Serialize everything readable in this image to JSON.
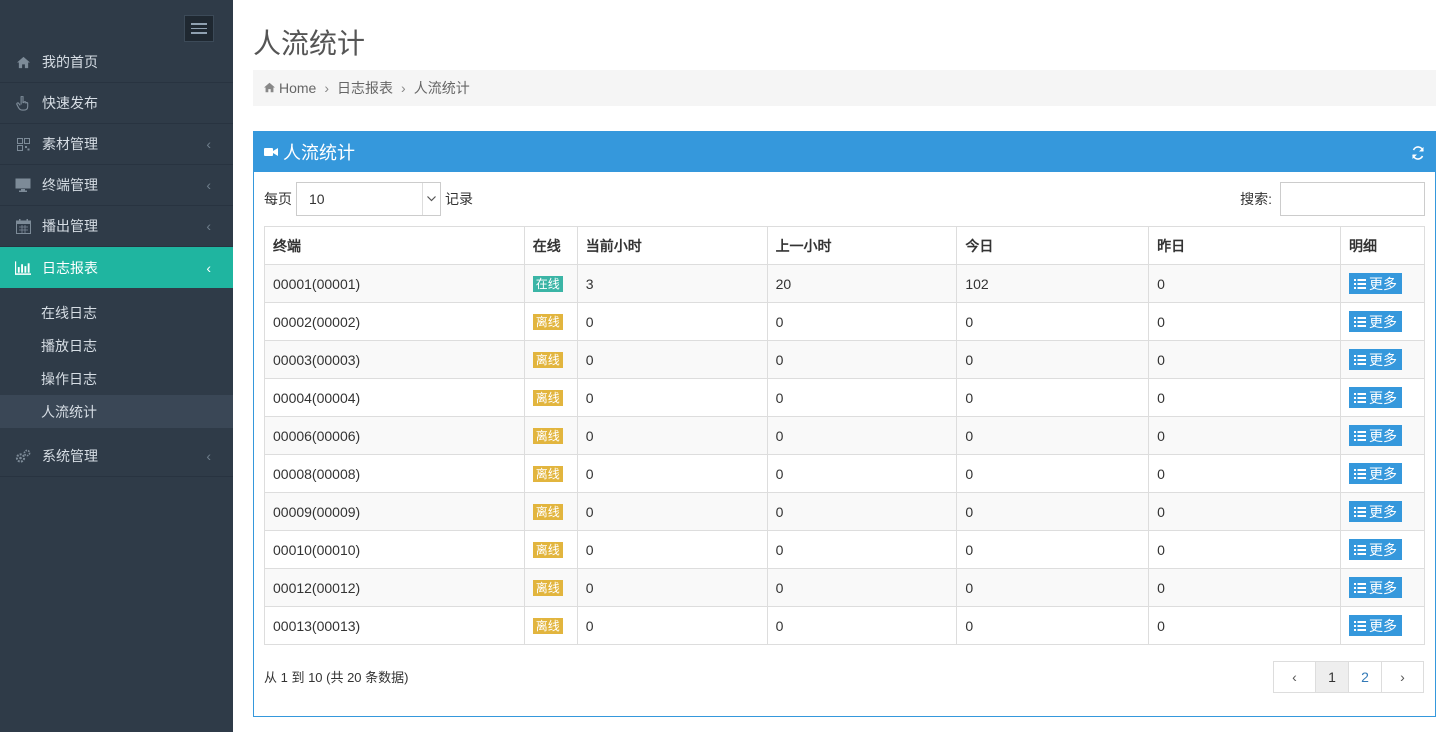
{
  "sidebar": {
    "menu": [
      {
        "label": "我的首页",
        "icon": "home-icon",
        "arrow": ""
      },
      {
        "label": "快速发布",
        "icon": "hand-pointer-icon",
        "arrow": ""
      },
      {
        "label": "素材管理",
        "icon": "qrcode-icon",
        "arrow": "‹"
      },
      {
        "label": "终端管理",
        "icon": "desktop-icon",
        "arrow": "‹"
      },
      {
        "label": "播出管理",
        "icon": "calendar-icon",
        "arrow": "‹"
      },
      {
        "label": "日志报表",
        "icon": "bar-chart-icon",
        "arrow": "‹"
      }
    ],
    "submenu": [
      "在线日志",
      "播放日志",
      "操作日志",
      "人流统计"
    ],
    "bottom_menu": {
      "label": "系统管理",
      "icon": "cogs-icon",
      "arrow": "‹"
    }
  },
  "page": {
    "title": "人流统计",
    "breadcrumb": [
      "Home",
      "日志报表",
      "人流统计"
    ]
  },
  "panel": {
    "title": "人流统计",
    "per_page_label": "每页",
    "per_page_value": "10",
    "records_label": "记录",
    "search_label": "搜索:",
    "search_value": ""
  },
  "table": {
    "headers": [
      "终端",
      "在线",
      "当前小时",
      "上一小时",
      "今日",
      "昨日",
      "明细"
    ],
    "rows": [
      {
        "terminal": "00001(00001)",
        "status": "在线",
        "online": true,
        "current_hour": "3",
        "last_hour": "20",
        "today": "102",
        "yesterday": "0"
      },
      {
        "terminal": "00002(00002)",
        "status": "离线",
        "online": false,
        "current_hour": "0",
        "last_hour": "0",
        "today": "0",
        "yesterday": "0"
      },
      {
        "terminal": "00003(00003)",
        "status": "离线",
        "online": false,
        "current_hour": "0",
        "last_hour": "0",
        "today": "0",
        "yesterday": "0"
      },
      {
        "terminal": "00004(00004)",
        "status": "离线",
        "online": false,
        "current_hour": "0",
        "last_hour": "0",
        "today": "0",
        "yesterday": "0"
      },
      {
        "terminal": "00006(00006)",
        "status": "离线",
        "online": false,
        "current_hour": "0",
        "last_hour": "0",
        "today": "0",
        "yesterday": "0"
      },
      {
        "terminal": "00008(00008)",
        "status": "离线",
        "online": false,
        "current_hour": "0",
        "last_hour": "0",
        "today": "0",
        "yesterday": "0"
      },
      {
        "terminal": "00009(00009)",
        "status": "离线",
        "online": false,
        "current_hour": "0",
        "last_hour": "0",
        "today": "0",
        "yesterday": "0"
      },
      {
        "terminal": "00010(00010)",
        "status": "离线",
        "online": false,
        "current_hour": "0",
        "last_hour": "0",
        "today": "0",
        "yesterday": "0"
      },
      {
        "terminal": "00012(00012)",
        "status": "离线",
        "online": false,
        "current_hour": "0",
        "last_hour": "0",
        "today": "0",
        "yesterday": "0"
      },
      {
        "terminal": "00013(00013)",
        "status": "离线",
        "online": false,
        "current_hour": "0",
        "last_hour": "0",
        "today": "0",
        "yesterday": "0"
      }
    ],
    "more_label": "更多"
  },
  "footer": {
    "info": "从 1 到 10 (共 20 条数据)",
    "pages": [
      "1",
      "2"
    ],
    "current_page": "1",
    "prev": "‹",
    "next": "›"
  },
  "colors": {
    "sidebar_bg": "#2f3b48",
    "active_menu": "#1fb5a0",
    "primary": "#3598dc",
    "online_badge": "#3bb5a6",
    "offline_badge": "#e2b53e"
  }
}
